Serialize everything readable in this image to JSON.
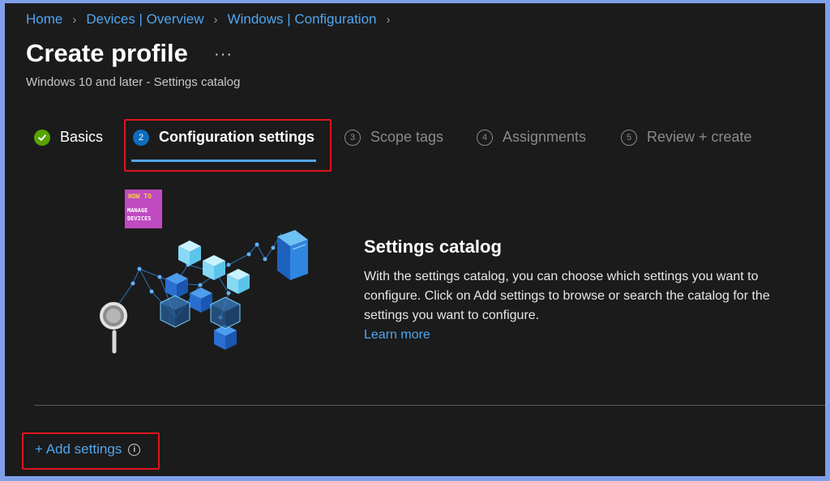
{
  "breadcrumb": {
    "items": [
      "Home",
      "Devices | Overview",
      "Windows | Configuration"
    ],
    "separator": "›"
  },
  "header": {
    "title": "Create profile",
    "more_label": "···",
    "subtitle": "Windows 10 and later - Settings catalog"
  },
  "steps": [
    {
      "number": "✓",
      "label": "Basics",
      "state": "done"
    },
    {
      "number": "2",
      "label": "Configuration settings",
      "state": "active"
    },
    {
      "number": "3",
      "label": "Scope tags",
      "state": "pending"
    },
    {
      "number": "4",
      "label": "Assignments",
      "state": "pending"
    },
    {
      "number": "5",
      "label": "Review + create",
      "state": "pending"
    }
  ],
  "logo": {
    "line1": "HOW TO",
    "line2": "MANAGE",
    "line3": "DEVICES"
  },
  "catalog": {
    "heading": "Settings catalog",
    "description": "With the settings catalog, you can choose which settings you want to configure. Click on Add settings to browse or search the catalog for the settings you want to configure.",
    "learn_more": "Learn more"
  },
  "actions": {
    "add_settings": "+ Add settings",
    "info_icon": "i"
  },
  "colors": {
    "background": "#1b1b1b",
    "link": "#4fa6f0",
    "highlight_box": "#e0141f",
    "step_done": "#57a300",
    "step_active": "#0f6cbd"
  },
  "icons": {
    "step_done": "checkmark-circle-icon",
    "more": "ellipsis-icon",
    "info": "info-icon",
    "illustration": "settings-catalog-illustration"
  }
}
